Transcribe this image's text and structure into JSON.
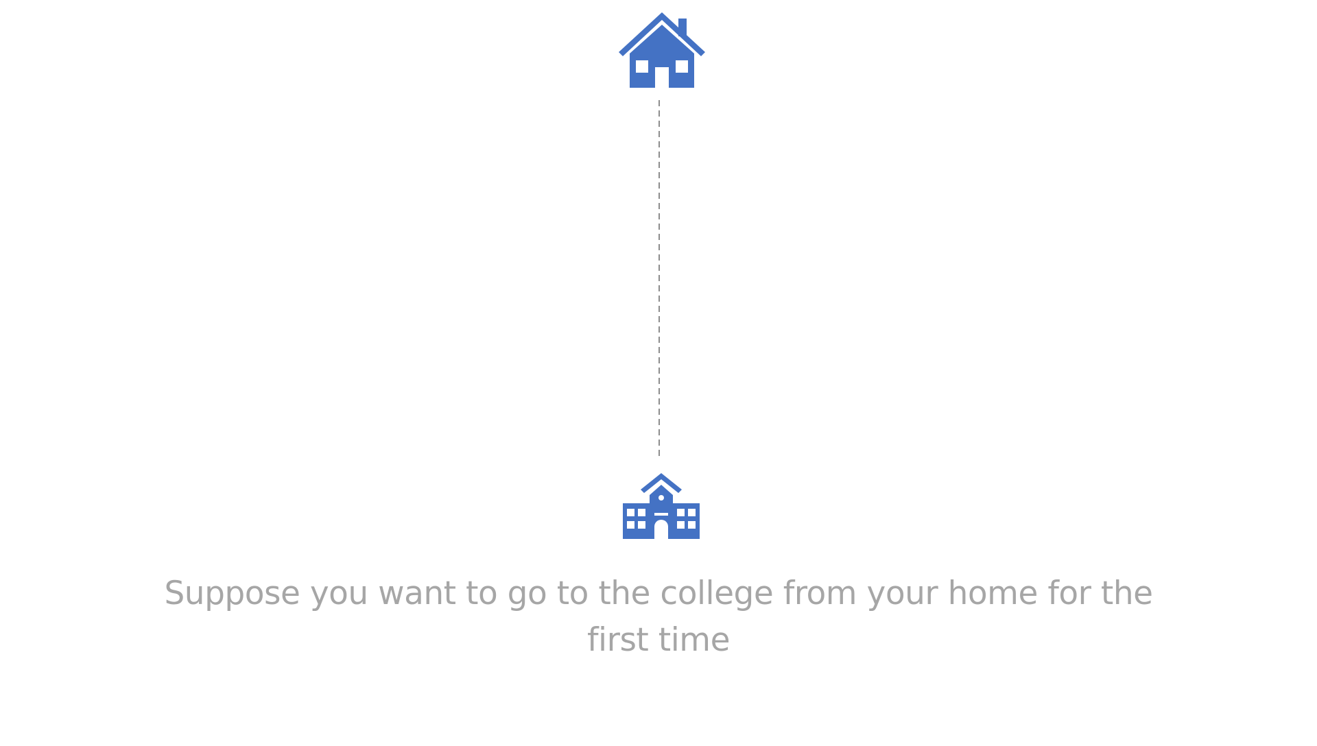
{
  "diagram": {
    "start_icon": "house-icon",
    "end_icon": "college-icon",
    "connector_style": "dashed",
    "colors": {
      "icon": "#4472c4",
      "connector": "#8c8c8c",
      "caption": "#a6a6a6",
      "background": "#ffffff"
    },
    "caption": "Suppose you want to go to the college from your home for the first time"
  }
}
